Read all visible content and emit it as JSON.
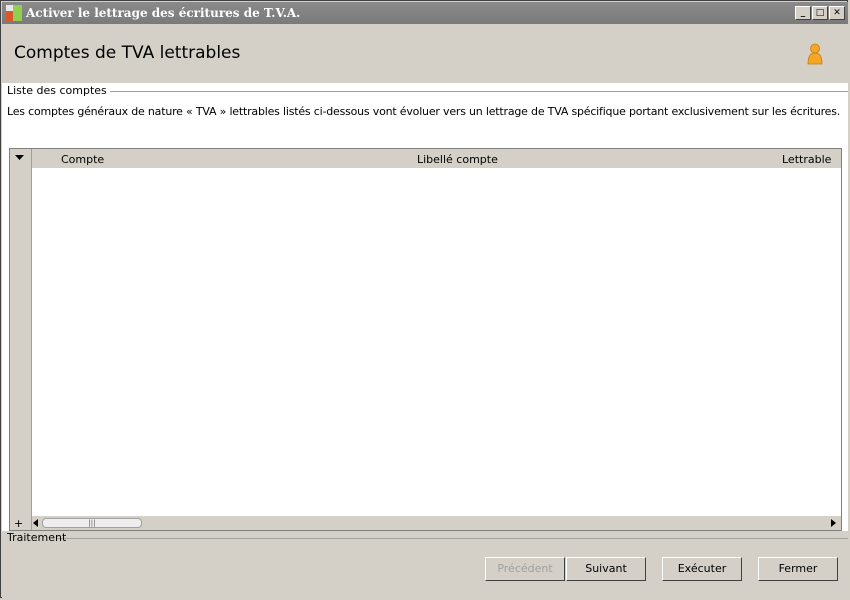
{
  "window": {
    "title": "Activer le lettrage des écritures de T.V.A."
  },
  "header": {
    "title": "Comptes de TVA lettrables"
  },
  "section_list": {
    "label": "Liste des comptes",
    "description": "Les comptes généraux de nature « TVA » lettrables listés ci-dessous vont évoluer vers un lettrage de TVA spécifique portant exclusivement sur les écritures."
  },
  "grid": {
    "columns": [
      "Compte",
      "Libellé compte",
      "Lettrable"
    ],
    "rows": [],
    "add_symbol": "+",
    "scroll_thumb_grip": "|||"
  },
  "section_treatment": {
    "label": "Traitement"
  },
  "buttons": {
    "previous": "Précédent",
    "next": "Suivant",
    "execute": "Exécuter",
    "close": "Fermer"
  },
  "window_controls": {
    "minimize": "_",
    "maximize": "□",
    "close": "✕"
  },
  "colors": {
    "titlebar": "#808080",
    "chrome": "#d4d0c8",
    "content": "#ffffff",
    "user_icon": "#f5a623"
  }
}
